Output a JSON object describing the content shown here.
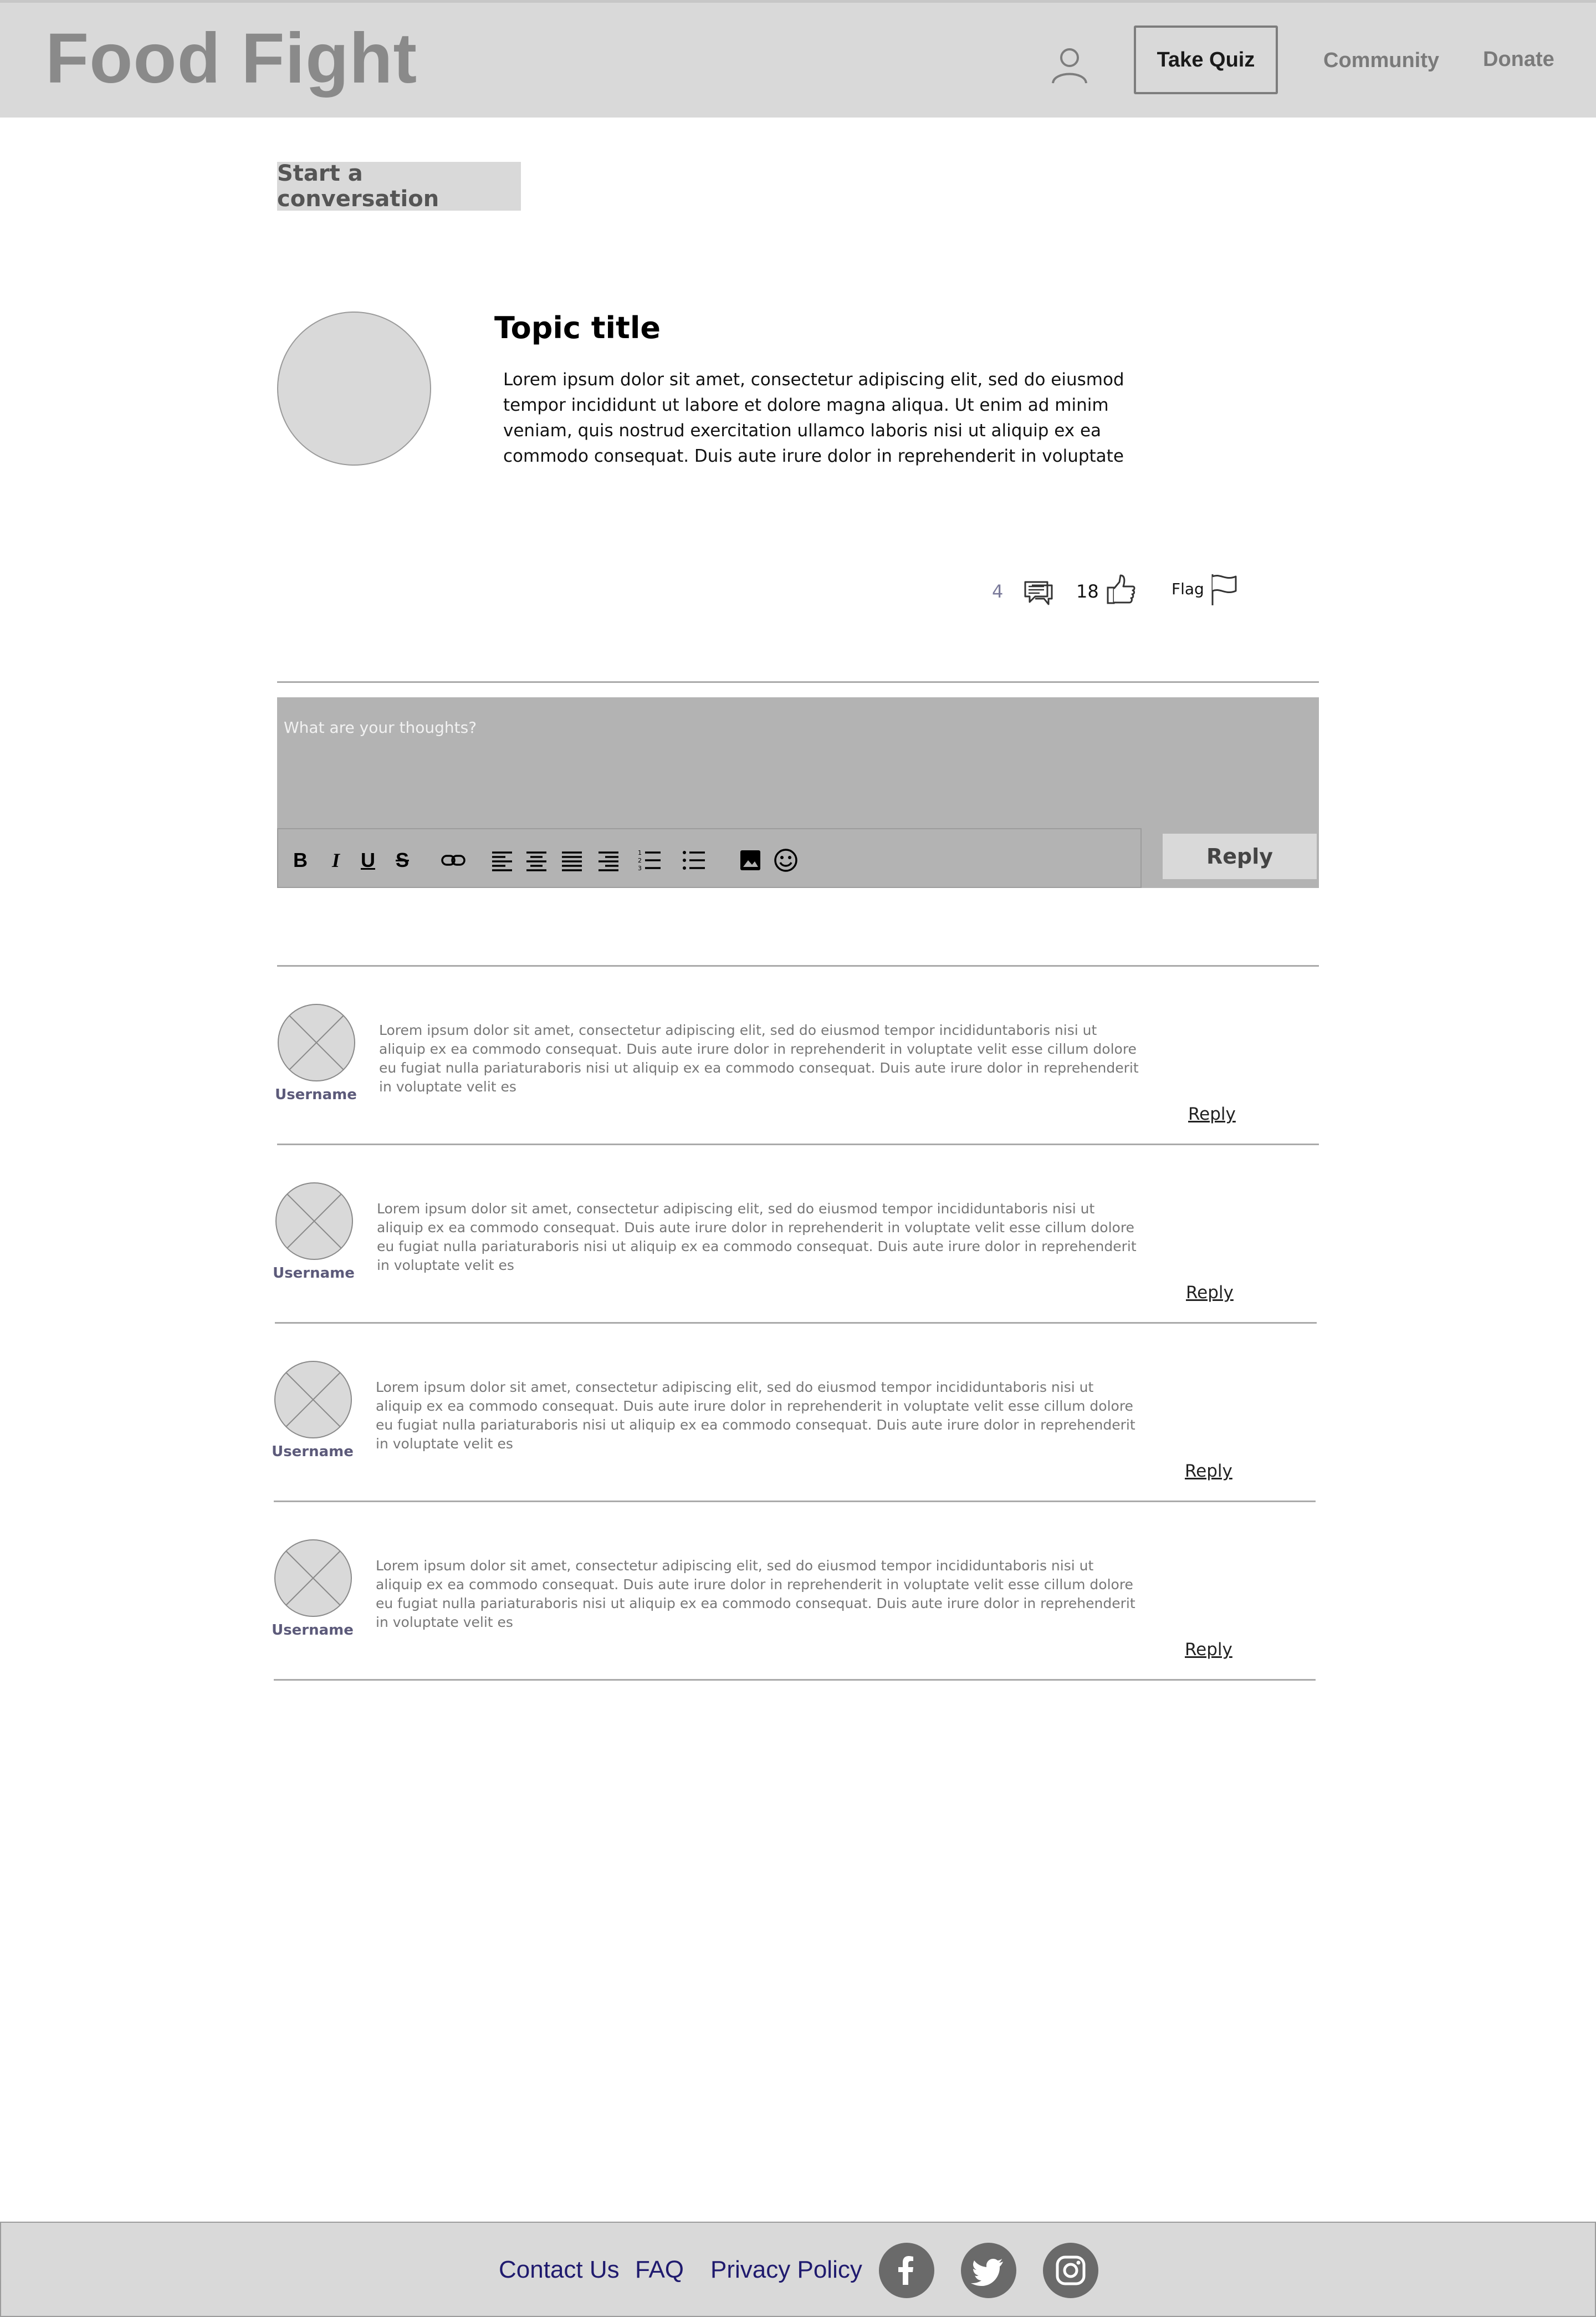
{
  "header": {
    "brand": "Food Fight",
    "take_quiz": "Take Quiz",
    "nav": [
      "Community",
      "Donate"
    ]
  },
  "start_conversation": "Start a conversation",
  "topic": {
    "title": "Topic title",
    "body": "Lorem ipsum dolor sit amet, consectetur adipiscing elit, sed do eiusmod tempor incididunt ut labore et dolore magna aliqua. Ut enim ad minim veniam, quis nostrud exercitation ullamco laboris nisi ut aliquip ex ea commodo consequat. Duis aute irure dolor in reprehenderit in voluptate velit esse cillum dolore eu fugiat nulla pariatur",
    "comment_count": "4",
    "like_count": "18",
    "flag_label": "Flag"
  },
  "editor": {
    "placeholder": "What are your thoughts?",
    "reply_button": "Reply",
    "toolbar": [
      "bold-icon",
      "italic-icon",
      "underline-icon",
      "strikethrough-icon",
      "link-icon",
      "align-left-icon",
      "align-center-icon",
      "align-justify-icon",
      "align-right-icon",
      "numbered-list-icon",
      "bulleted-list-icon",
      "image-icon",
      "emoji-icon"
    ]
  },
  "comments": [
    {
      "username": "Username",
      "text": "Lorem ipsum dolor sit amet, consectetur adipiscing elit, sed do eiusmod tempor incididuntaboris nisi ut aliquip ex ea commodo consequat. Duis aute irure dolor in reprehenderit in voluptate velit esse cillum dolore eu fugiat nulla pariaturaboris nisi ut aliquip ex ea commodo consequat. Duis aute irure dolor in reprehenderit in voluptate velit es",
      "reply": "Reply"
    },
    {
      "username": "Username",
      "text": "Lorem ipsum dolor sit amet, consectetur adipiscing elit, sed do eiusmod tempor incididuntaboris nisi ut aliquip ex ea commodo consequat. Duis aute irure dolor in reprehenderit in voluptate velit esse cillum dolore eu fugiat nulla pariaturaboris nisi ut aliquip ex ea commodo consequat. Duis aute irure dolor in reprehenderit in voluptate velit es",
      "reply": "Reply"
    },
    {
      "username": "Username",
      "text": "Lorem ipsum dolor sit amet, consectetur adipiscing elit, sed do eiusmod tempor incididuntaboris nisi ut aliquip ex ea commodo consequat. Duis aute irure dolor in reprehenderit in voluptate velit esse cillum dolore eu fugiat nulla pariaturaboris nisi ut aliquip ex ea commodo consequat. Duis aute irure dolor in reprehenderit in voluptate velit es",
      "reply": "Reply"
    },
    {
      "username": "Username",
      "text": "Lorem ipsum dolor sit amet, consectetur adipiscing elit, sed do eiusmod tempor incididuntaboris nisi ut aliquip ex ea commodo consequat. Duis aute irure dolor in reprehenderit in voluptate velit esse cillum dolore eu fugiat nulla pariaturaboris nisi ut aliquip ex ea commodo consequat. Duis aute irure dolor in reprehenderit in voluptate velit es",
      "reply": "Reply"
    }
  ],
  "footer": {
    "links": [
      "Contact Us",
      "FAQ",
      "Privacy Policy"
    ],
    "social": [
      "facebook-icon",
      "twitter-icon",
      "instagram-icon"
    ]
  }
}
